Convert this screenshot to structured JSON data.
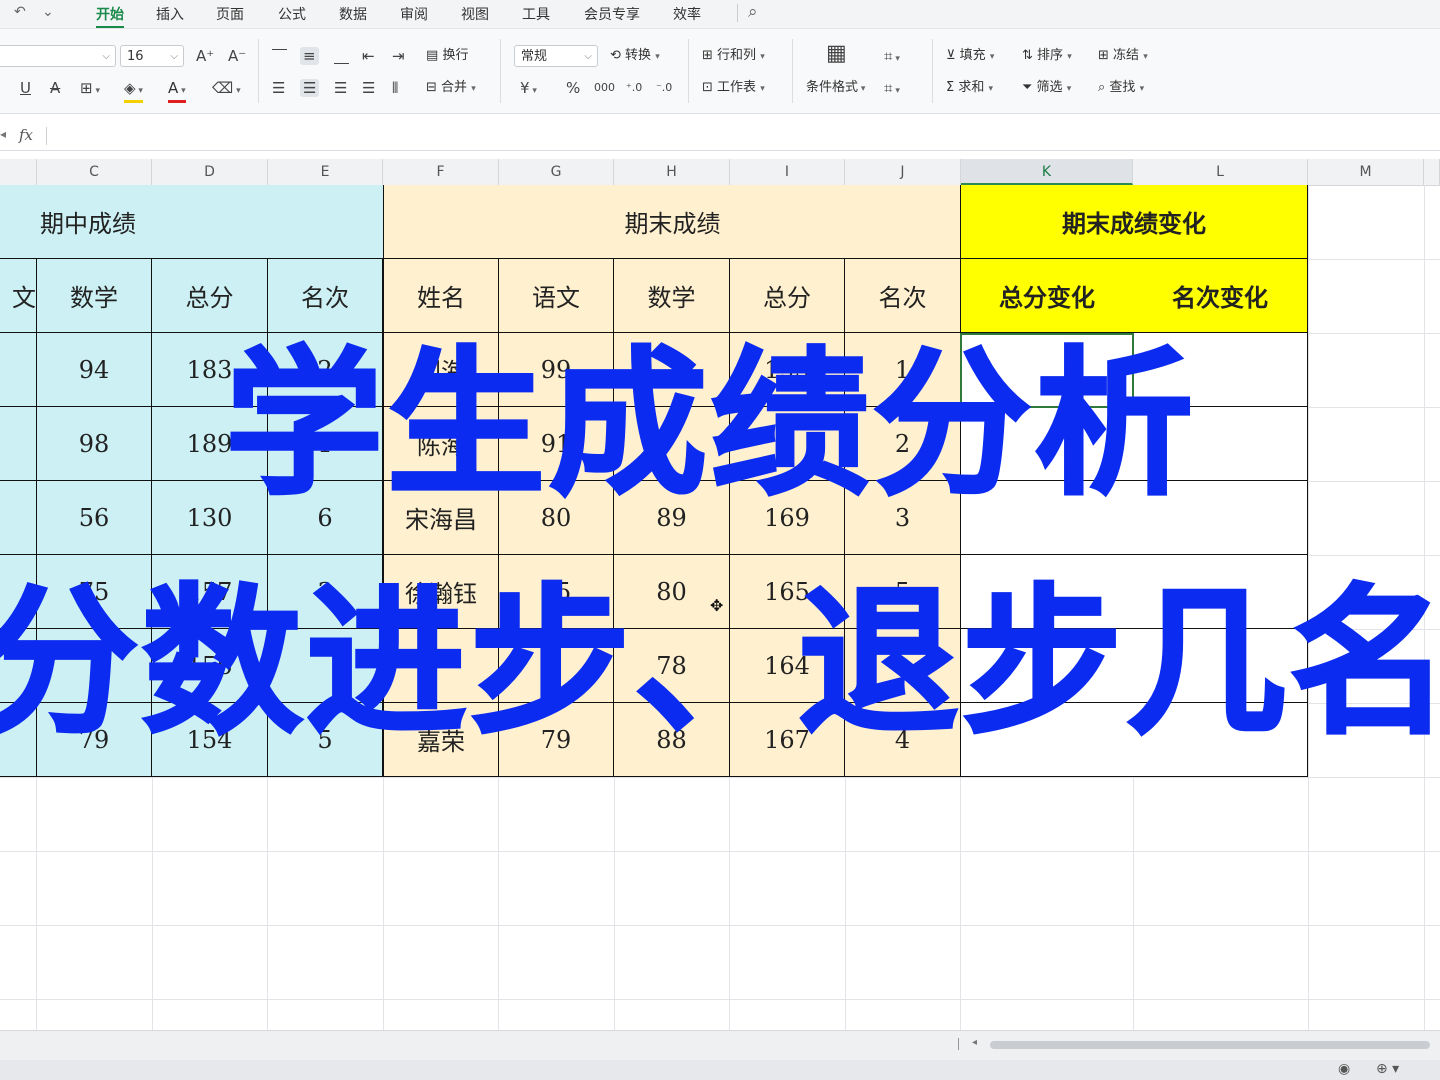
{
  "menu": {
    "quick_access": [
      "↶",
      "⌄"
    ],
    "tabs": [
      "开始",
      "插入",
      "页面",
      "公式",
      "数据",
      "审阅",
      "视图",
      "工具",
      "会员专享",
      "效率"
    ],
    "active_tab": "开始"
  },
  "ribbon": {
    "font_size": "16",
    "wrap": "换行",
    "merge": "合并",
    "number_format": "常规",
    "convert": "转换",
    "rows_cols": "行和列",
    "worksheet": "工作表",
    "cond_format": "条件格式",
    "fill": "填充",
    "sort": "排序",
    "freeze": "冻结",
    "sum": "求和",
    "filter": "筛选",
    "find": "查找",
    "currency": "¥",
    "percent": "%"
  },
  "formula_bar": {
    "fx": "fx",
    "value": ""
  },
  "columns": [
    "C",
    "D",
    "E",
    "F",
    "G",
    "H",
    "I",
    "J",
    "K",
    "L",
    "M"
  ],
  "selected_column": "K",
  "table": {
    "midterm_title": "期中成绩",
    "final_title": "期末成绩",
    "change_title": "期末成绩变化",
    "mid_headers": [
      "文",
      "数学",
      "总分",
      "名次"
    ],
    "final_headers": [
      "姓名",
      "语文",
      "数学",
      "总分",
      "名次"
    ],
    "change_headers": [
      "总分变化",
      "名次变化"
    ],
    "mid_rows": [
      [
        "94",
        "183",
        "2"
      ],
      [
        "98",
        "189",
        "1"
      ],
      [
        "56",
        "130",
        "6"
      ],
      [
        "75",
        "157",
        "3"
      ],
      [
        "",
        "156",
        ""
      ],
      [
        "79",
        "154",
        "5"
      ]
    ],
    "final_rows": [
      [
        "刘海",
        "99",
        "",
        "195",
        "1"
      ],
      [
        "陈海",
        "91",
        "",
        "",
        "2"
      ],
      [
        "宋海昌",
        "80",
        "89",
        "169",
        "3"
      ],
      [
        "徐瀚钰",
        "85",
        "80",
        "165",
        "5"
      ],
      [
        "",
        "",
        "78",
        "164",
        ""
      ],
      [
        "嘉荣",
        "79",
        "88",
        "167",
        "4"
      ]
    ]
  },
  "overlay": {
    "line1": "学生成绩分析",
    "line2": "分数进步、退步几名"
  },
  "colors": {
    "active_tab": "#1a8a4a",
    "midterm_fill": "#ccf0f4",
    "final_fill": "#fff0cf",
    "change_fill": "#ffff00",
    "overlay_text": "#0b2bf0"
  }
}
